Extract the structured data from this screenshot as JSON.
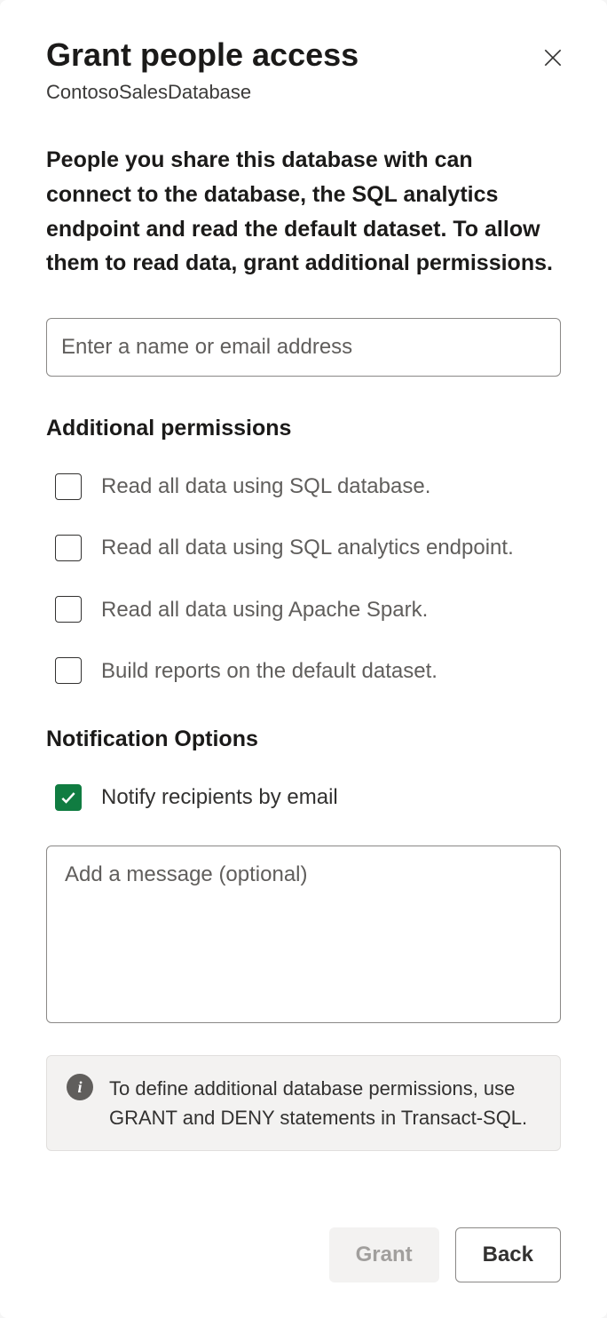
{
  "dialog": {
    "title": "Grant people access",
    "subtitle": "ContosoSalesDatabase",
    "description": "People you share this database with can connect to the database, the SQL analytics endpoint and read the default dataset. To allow them to read data, grant additional permissions.",
    "name_input_placeholder": "Enter a name or email address",
    "permissions": {
      "heading": "Additional permissions",
      "items": [
        {
          "label": "Read all data using SQL database.",
          "checked": false
        },
        {
          "label": "Read all data using SQL analytics endpoint.",
          "checked": false
        },
        {
          "label": "Read all data using Apache Spark.",
          "checked": false
        },
        {
          "label": "Build reports on the default dataset.",
          "checked": false
        }
      ]
    },
    "notification": {
      "heading": "Notification Options",
      "notify_label": "Notify recipients by email",
      "notify_checked": true,
      "message_placeholder": "Add a message (optional)"
    },
    "info": {
      "text": "To define additional database permissions, use GRANT and DENY statements in Transact-SQL."
    },
    "buttons": {
      "grant": "Grant",
      "back": "Back"
    }
  }
}
